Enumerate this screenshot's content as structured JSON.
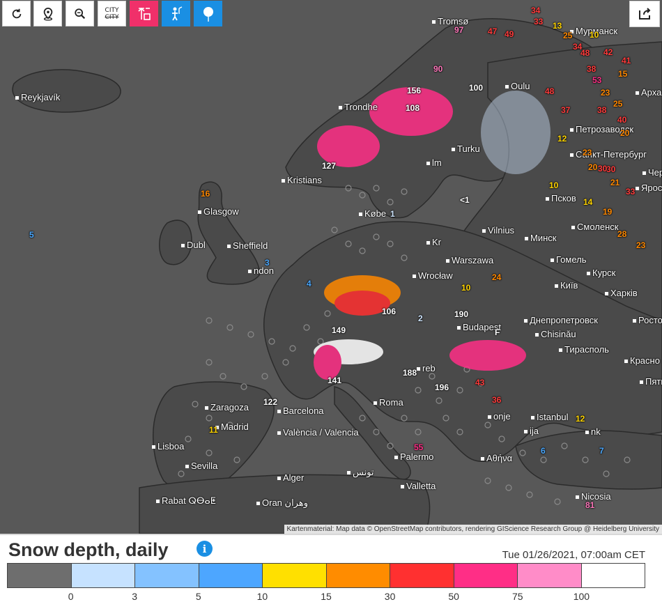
{
  "toolbar": {
    "buttons": [
      {
        "name": "refresh-button",
        "icon": "refresh-icon"
      },
      {
        "name": "location-button",
        "icon": "map-pin-icon"
      },
      {
        "name": "zoom-button",
        "icon": "zoom-icon"
      },
      {
        "name": "city-toggle-button",
        "icon": "city-icon",
        "line1": "CITY",
        "line2": "CITY"
      },
      {
        "name": "station-button",
        "icon": "weather-station-icon"
      },
      {
        "name": "observer-button",
        "icon": "observer-icon"
      },
      {
        "name": "balloon-button",
        "icon": "balloon-icon"
      }
    ],
    "share_icon": "share-icon"
  },
  "cities": [
    {
      "name": "Reykjavík"
    },
    {
      "name": "Tromsø"
    },
    {
      "name": "Мурманск"
    },
    {
      "name": "Архангельск",
      "short": "Арха"
    },
    {
      "name": "Trondheim",
      "short": "Trondhe"
    },
    {
      "name": "Oulu",
      "short": "Oulu"
    },
    {
      "name": "Петрозаводск",
      "short": "Петрозаводск"
    },
    {
      "name": "Turku"
    },
    {
      "name": "Санкт-Петербург",
      "short": "Санкт-Петербург"
    },
    {
      "name": "Kristiansand",
      "short": "Kristians"
    },
    {
      "name": "Stockholm",
      "short": "lm"
    },
    {
      "name": "Glasgow",
      "short": "Glasgow"
    },
    {
      "name": "Dublin",
      "short": "Dubl"
    },
    {
      "name": "Sheffield",
      "short": "Sheffield"
    },
    {
      "name": "London",
      "short": "ndon"
    },
    {
      "name": "København",
      "short": "Købe"
    },
    {
      "name": "Псков"
    },
    {
      "name": "Vilnius"
    },
    {
      "name": "Минск"
    },
    {
      "name": "Смоленск",
      "short": "Смоленск"
    },
    {
      "name": "Warszawa"
    },
    {
      "name": "Гомель"
    },
    {
      "name": "Wrocław"
    },
    {
      "name": "Київ"
    },
    {
      "name": "Курск"
    },
    {
      "name": "Харків"
    },
    {
      "name": "Днепропетровск"
    },
    {
      "name": "Chisinău"
    },
    {
      "name": "Тирасполь"
    },
    {
      "name": "Budapest"
    },
    {
      "name": "Zagreb",
      "short": "reb"
    },
    {
      "name": "Zaragoza"
    },
    {
      "name": "Barcelona"
    },
    {
      "name": "Madrid"
    },
    {
      "name": "València / Valencia"
    },
    {
      "name": "Lisboa"
    },
    {
      "name": "Sevilla"
    },
    {
      "name": "Roma"
    },
    {
      "name": "Palermo"
    },
    {
      "name": "Valletta"
    },
    {
      "name": "Alger"
    },
    {
      "name": "Rabat ⵕⴱⴰⵟ الرباط",
      "short": "Rabat ⵕⴱⴰⵟ"
    },
    {
      "name": "Oran وهران"
    },
    {
      "name": "تونس"
    },
    {
      "name": "Istanbul"
    },
    {
      "name": "Αθήνα"
    },
    {
      "name": "Nicosia"
    },
    {
      "name": "Ankara",
      "short": "nk"
    },
    {
      "name": "Ростов"
    },
    {
      "name": "Красно"
    },
    {
      "name": "Пятигорск",
      "short": "Пяти"
    },
    {
      "name": "Ярославль",
      "short": "Ярос"
    },
    {
      "name": "Черепо",
      "short": "Чер"
    },
    {
      "name": "Podgorica",
      "short": "onje"
    },
    {
      "name": "Sofia",
      "short": "ija"
    },
    {
      "name": "Kraków",
      "short": "Kr"
    }
  ],
  "values": [
    {
      "v": "34",
      "c": "#ff3b3b"
    },
    {
      "v": "33",
      "c": "#ff3b3b"
    },
    {
      "v": "13",
      "c": "#ffd400"
    },
    {
      "v": "10",
      "c": "#ffd400"
    },
    {
      "v": "25",
      "c": "#ff8800"
    },
    {
      "v": "34",
      "c": "#ff3b3b"
    },
    {
      "v": "48",
      "c": "#ff3b3b"
    },
    {
      "v": "42",
      "c": "#ff3b3b"
    },
    {
      "v": "41",
      "c": "#ff3b3b"
    },
    {
      "v": "38",
      "c": "#ff3b3b"
    },
    {
      "v": "15",
      "c": "#ff8800"
    },
    {
      "v": "53",
      "c": "#ff2e86"
    },
    {
      "v": "97",
      "c": "#ff77bb"
    },
    {
      "v": "47",
      "c": "#ff3b3b"
    },
    {
      "v": "49",
      "c": "#ff3b3b"
    },
    {
      "v": "90",
      "c": "#ff77bb"
    },
    {
      "v": "100",
      "c": "#ffffff"
    },
    {
      "v": "108",
      "c": "#ffffff"
    },
    {
      "v": "156",
      "c": "#ffffff"
    },
    {
      "v": "48",
      "c": "#ff3b3b"
    },
    {
      "v": "37",
      "c": "#ff3b3b"
    },
    {
      "v": "23",
      "c": "#ff8800"
    },
    {
      "v": "40",
      "c": "#ff3b3b"
    },
    {
      "v": "25",
      "c": "#ff8800"
    },
    {
      "v": "38",
      "c": "#ff3b3b"
    },
    {
      "v": "20",
      "c": "#ff8800"
    },
    {
      "v": "30",
      "c": "#ff3b3b"
    },
    {
      "v": "23",
      "c": "#ff8800"
    },
    {
      "v": "20",
      "c": "#ff8800"
    },
    {
      "v": "30",
      "c": "#ff3b3b"
    },
    {
      "v": "12",
      "c": "#ffd400"
    },
    {
      "v": "10",
      "c": "#ffd400"
    },
    {
      "v": "16",
      "c": "#ff8800"
    },
    {
      "v": "127",
      "c": "#ffffff"
    },
    {
      "v": "14",
      "c": "#ffd400"
    },
    {
      "v": "21",
      "c": "#ff8800"
    },
    {
      "v": "33",
      "c": "#ff3b3b"
    },
    {
      "v": "19",
      "c": "#ff8800"
    },
    {
      "v": "28",
      "c": "#ff8800"
    },
    {
      "v": "23",
      "c": "#ff8800"
    },
    {
      "v": "24",
      "c": "#ff8800"
    },
    {
      "v": "10",
      "c": "#ffd400"
    },
    {
      "v": "106",
      "c": "#ffffff"
    },
    {
      "v": "190",
      "c": "#ffffff"
    },
    {
      "v": "149",
      "c": "#ffffff"
    },
    {
      "v": "188",
      "c": "#ffffff"
    },
    {
      "v": "196",
      "c": "#ffffff"
    },
    {
      "v": "141",
      "c": "#ffffff"
    },
    {
      "v": "122",
      "c": "#ffffff"
    },
    {
      "v": "55",
      "c": "#ff2e86"
    },
    {
      "v": "81",
      "c": "#ff77bb"
    },
    {
      "v": "36",
      "c": "#ff3b3b"
    },
    {
      "v": "43",
      "c": "#ff3b3b"
    },
    {
      "v": "12",
      "c": "#ffd400"
    },
    {
      "v": "11",
      "c": "#ffd400"
    },
    {
      "v": "5",
      "c": "#4aa8ff"
    },
    {
      "v": "4",
      "c": "#4aa8ff"
    },
    {
      "v": "3",
      "c": "#4aa8ff"
    },
    {
      "v": "1",
      "c": "#cfe6ff"
    },
    {
      "v": "<1",
      "c": "#ffffff"
    },
    {
      "v": "F",
      "c": "#ffffff"
    },
    {
      "v": "7",
      "c": "#4aa8ff"
    },
    {
      "v": "2",
      "c": "#cfe6ff"
    },
    {
      "v": "6",
      "c": "#4aa8ff"
    }
  ],
  "attribution": "Kartenmaterial: Map data © OpenStreetMap contributors, rendering GIScience Research Group @ Heidelberg University",
  "legend": {
    "title": "Snow depth, daily",
    "info_icon": "info-icon",
    "timestamp": "Tue 01/26/2021, 07:00am CET",
    "swatches": [
      "#6e6e6e",
      "#c6e2ff",
      "#84c2ff",
      "#4da6ff",
      "#ffe000",
      "#ff8c00",
      "#ff3030",
      "#ff2e86",
      "#ff8cc8",
      "#ffffff"
    ],
    "ticks": [
      "0",
      "3",
      "5",
      "10",
      "15",
      "30",
      "50",
      "75",
      "100"
    ]
  }
}
